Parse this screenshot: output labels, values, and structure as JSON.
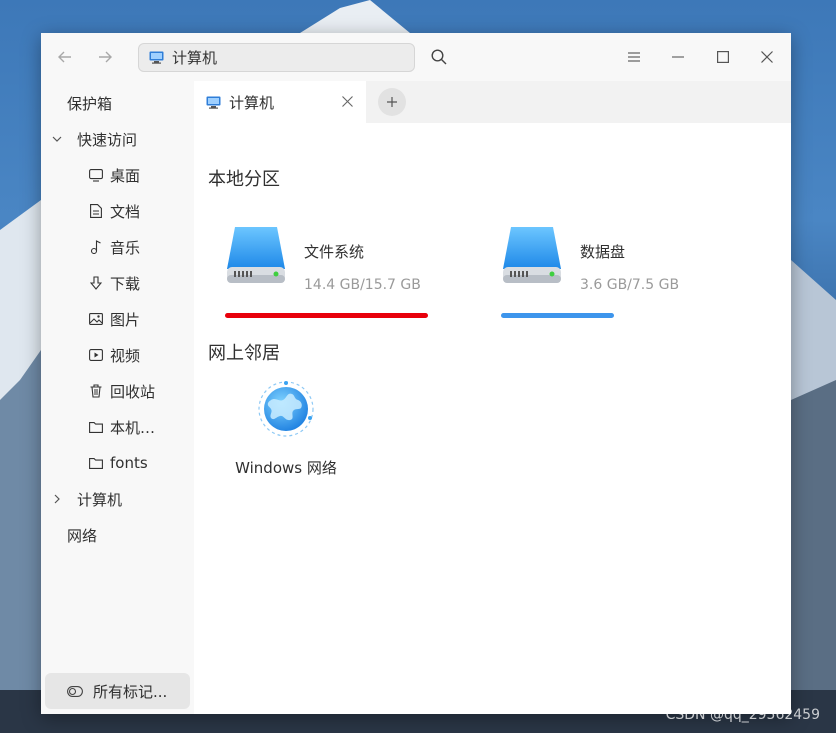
{
  "window": {
    "address_path": "计算机"
  },
  "sidebar": {
    "items": [
      {
        "label": "保护箱",
        "icon": "none"
      },
      {
        "label": "快速访问",
        "icon": "chevron-down-icon"
      },
      {
        "label": "桌面",
        "icon": "desktop-icon"
      },
      {
        "label": "文档",
        "icon": "document-icon"
      },
      {
        "label": "音乐",
        "icon": "music-icon"
      },
      {
        "label": "下载",
        "icon": "download-icon"
      },
      {
        "label": "图片",
        "icon": "picture-icon"
      },
      {
        "label": "视频",
        "icon": "video-icon"
      },
      {
        "label": "回收站",
        "icon": "trash-icon"
      },
      {
        "label": "本机…",
        "icon": "folder-icon"
      },
      {
        "label": "fonts",
        "icon": "folder-icon"
      },
      {
        "label": "计算机",
        "icon": "chevron-right-icon"
      },
      {
        "label": "网络",
        "icon": "none"
      }
    ],
    "tags_label": "所有标记..."
  },
  "tabs": [
    {
      "label": "计算机"
    }
  ],
  "local": {
    "title": "本地分区",
    "disks": [
      {
        "name": "文件系统",
        "size": "14.4 GB/15.7 GB",
        "usage": 0.917,
        "bar_color": "#e8000b"
      },
      {
        "name": "数据盘",
        "size": "3.6 GB/7.5 GB",
        "usage": 0.48,
        "bar_color": "#3d95ec"
      }
    ]
  },
  "network": {
    "title": "网上邻居",
    "items": [
      {
        "label": "Windows 网络"
      }
    ]
  },
  "watermark": "CSDN @qq_29562459",
  "colors": {
    "accent": "#3d95ec",
    "danger": "#e8000b"
  }
}
